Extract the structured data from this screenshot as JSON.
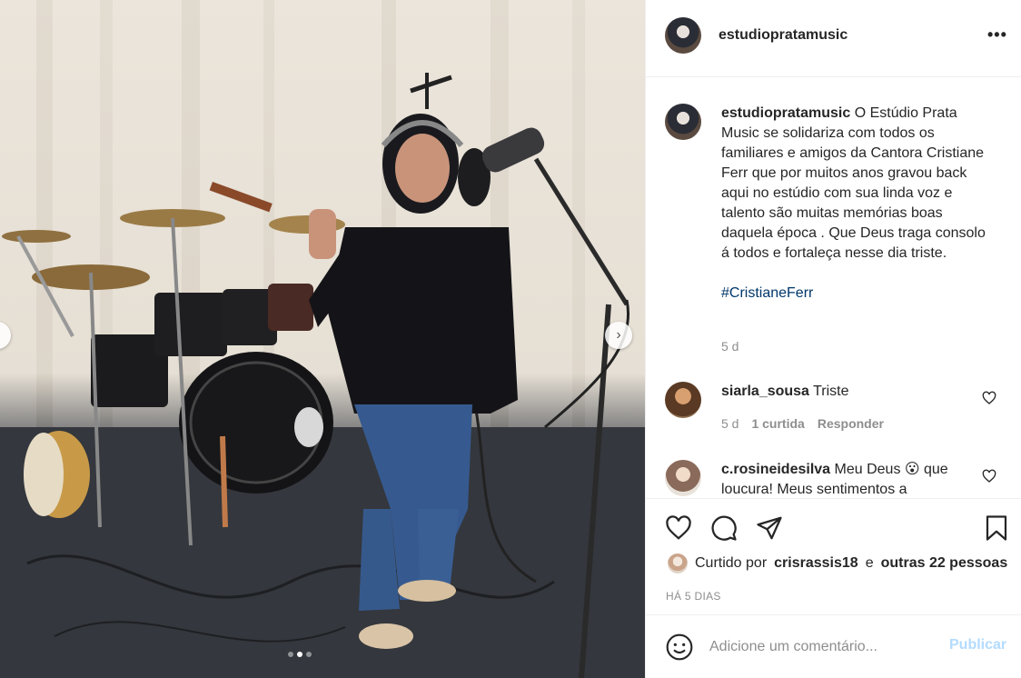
{
  "post": {
    "username": "estudiopratamusic",
    "more_icon": "more-horizontal-icon",
    "image_alt_icon": "photo"
  },
  "carousel": {
    "slide_count": 3,
    "active_index": 1
  },
  "caption": {
    "username": "estudiopratamusic",
    "text": "O Estúdio Prata Music se solidariza com todos os familiares e amigos da Cantora Cristiane Ferr que por muitos anos gravou back aqui no estúdio com sua linda voz e talento são muitas memórias boas daquela época . Que Deus traga consolo á todos e fortaleça nesse dia triste.",
    "hashtag": "#CristianeFerr",
    "time": "5 d"
  },
  "comments": [
    {
      "username": "siarla_sousa",
      "text": "Triste",
      "time": "5 d",
      "likes": "1 curtida",
      "reply": "Responder"
    },
    {
      "username": "c.rosineidesilva",
      "text": "Meu Deus 😮 que loucura! Meus sentimentos a"
    }
  ],
  "likes": {
    "prefix": "Curtido por",
    "user": "crisrassis18",
    "joiner": "e",
    "others": "outras 22 pessoas"
  },
  "date": "HÁ 5 DIAS",
  "add_comment": {
    "placeholder": "Adicione um comentário...",
    "publish": "Publicar"
  },
  "colors": {
    "accent_link": "#00376b",
    "publish_disabled": "#b3dbff",
    "muted": "#8e8e8e"
  }
}
